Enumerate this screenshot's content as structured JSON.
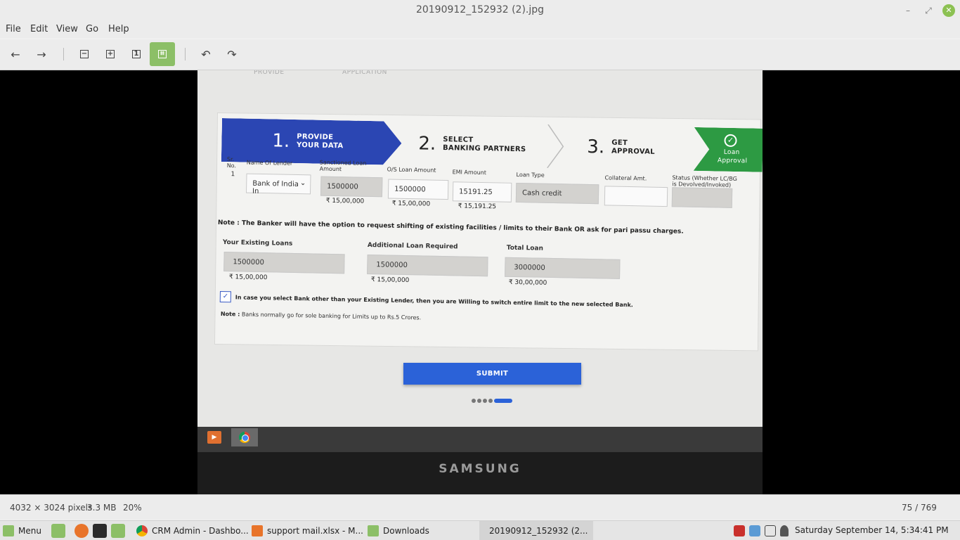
{
  "window": {
    "title": "20190912_152932 (2).jpg",
    "minimize": "–",
    "maximize": "⤢",
    "close": "✕"
  },
  "menu": [
    "File",
    "Edit",
    "View",
    "Go",
    "Help"
  ],
  "toolbar": {
    "icons": [
      "back-arrow-icon",
      "forward-arrow-icon",
      "zoom-out-icon",
      "zoom-in-icon",
      "normal-size-icon",
      "best-fit-icon",
      "rotate-left-icon",
      "rotate-right-icon"
    ],
    "active": "best-fit-icon",
    "glyphs": {
      "back": "←",
      "forward": "→",
      "zoom_out": "−",
      "zoom_in": "+",
      "normal": "1",
      "fit": "⌗",
      "rotate_left": "↶",
      "rotate_right": "↷"
    }
  },
  "photo": {
    "ghost_header": [
      "PROVIDE",
      "APPLICATION"
    ],
    "steps": [
      {
        "num": "1.",
        "line1": "PROVIDE",
        "line2": "YOUR DATA"
      },
      {
        "num": "2.",
        "line1": "SELECT",
        "line2": "BANKING PARTNERS"
      },
      {
        "num": "3.",
        "line1": "GET",
        "line2": "APPROVAL"
      },
      {
        "check": "✓",
        "line1": "Loan",
        "line2": "Approval"
      }
    ],
    "step_colors": {
      "active": "#2b46b3",
      "done": "#2d9a43"
    },
    "table": {
      "headers": {
        "sr": "Sr.\nNo.",
        "lender": "Name Of Lender",
        "sanctioned": "Sanctioned Loan Amount",
        "os": "O/S Loan Amount",
        "emi": "EMI Amount",
        "type": "Loan Type",
        "collateral": "Collateral Amt.",
        "status": "Status (Whether LC/BG is Devolved/Invoked)"
      },
      "row": {
        "sr": "1",
        "lender": "Bank of India In",
        "sanctioned": "1500000",
        "sanctioned_fmt": "₹ 15,00,000",
        "os": "1500000",
        "os_fmt": "₹ 15,00,000",
        "emi": "15191.25",
        "emi_fmt": "₹ 15,191.25",
        "type": "Cash credit",
        "collateral": "",
        "status": ""
      }
    },
    "note1": "Note : The Banker will have the option to request shifting of existing facilities / limits to their Bank OR ask for pari passu charges.",
    "totals": [
      {
        "label": "Your Existing Loans",
        "value": "1500000",
        "fmt": "₹ 15,00,000"
      },
      {
        "label": "Additional Loan Required",
        "value": "1500000",
        "fmt": "₹ 15,00,000"
      },
      {
        "label": "Total Loan",
        "value": "3000000",
        "fmt": "₹ 30,00,000"
      }
    ],
    "checkbox": {
      "checked": true,
      "mark": "✓",
      "text": "In case you select Bank other than your Existing Lender, then you are Willing to switch entire limit to the new selected Bank."
    },
    "note2": {
      "prefix": "Note :",
      "text": " Banks normally go for sole banking for Limits up to Rs.5 Crores."
    },
    "submit": "SUBMIT",
    "pager_dots": {
      "count": 5,
      "active_index": 4
    },
    "monitor_brand": "SAMSUNG",
    "accent": "#2b62d8"
  },
  "status": {
    "dimensions": "4032 × 3024 pixels",
    "size": "3.3 MB",
    "zoom": "20%",
    "position": "75 / 769"
  },
  "taskbar": {
    "menu": "Menu",
    "tasks": [
      {
        "label": "CRM Admin - Dashbo...",
        "icon": "chrome-icon"
      },
      {
        "label": "support mail.xlsx - M...",
        "icon": "spreadsheet-icon"
      },
      {
        "label": "Downloads",
        "icon": "folder-icon"
      },
      {
        "label": "20190912_152932 (2...",
        "icon": "image-viewer-icon",
        "active": true
      }
    ],
    "clock": "Saturday September 14,  5:34:41 PM"
  }
}
